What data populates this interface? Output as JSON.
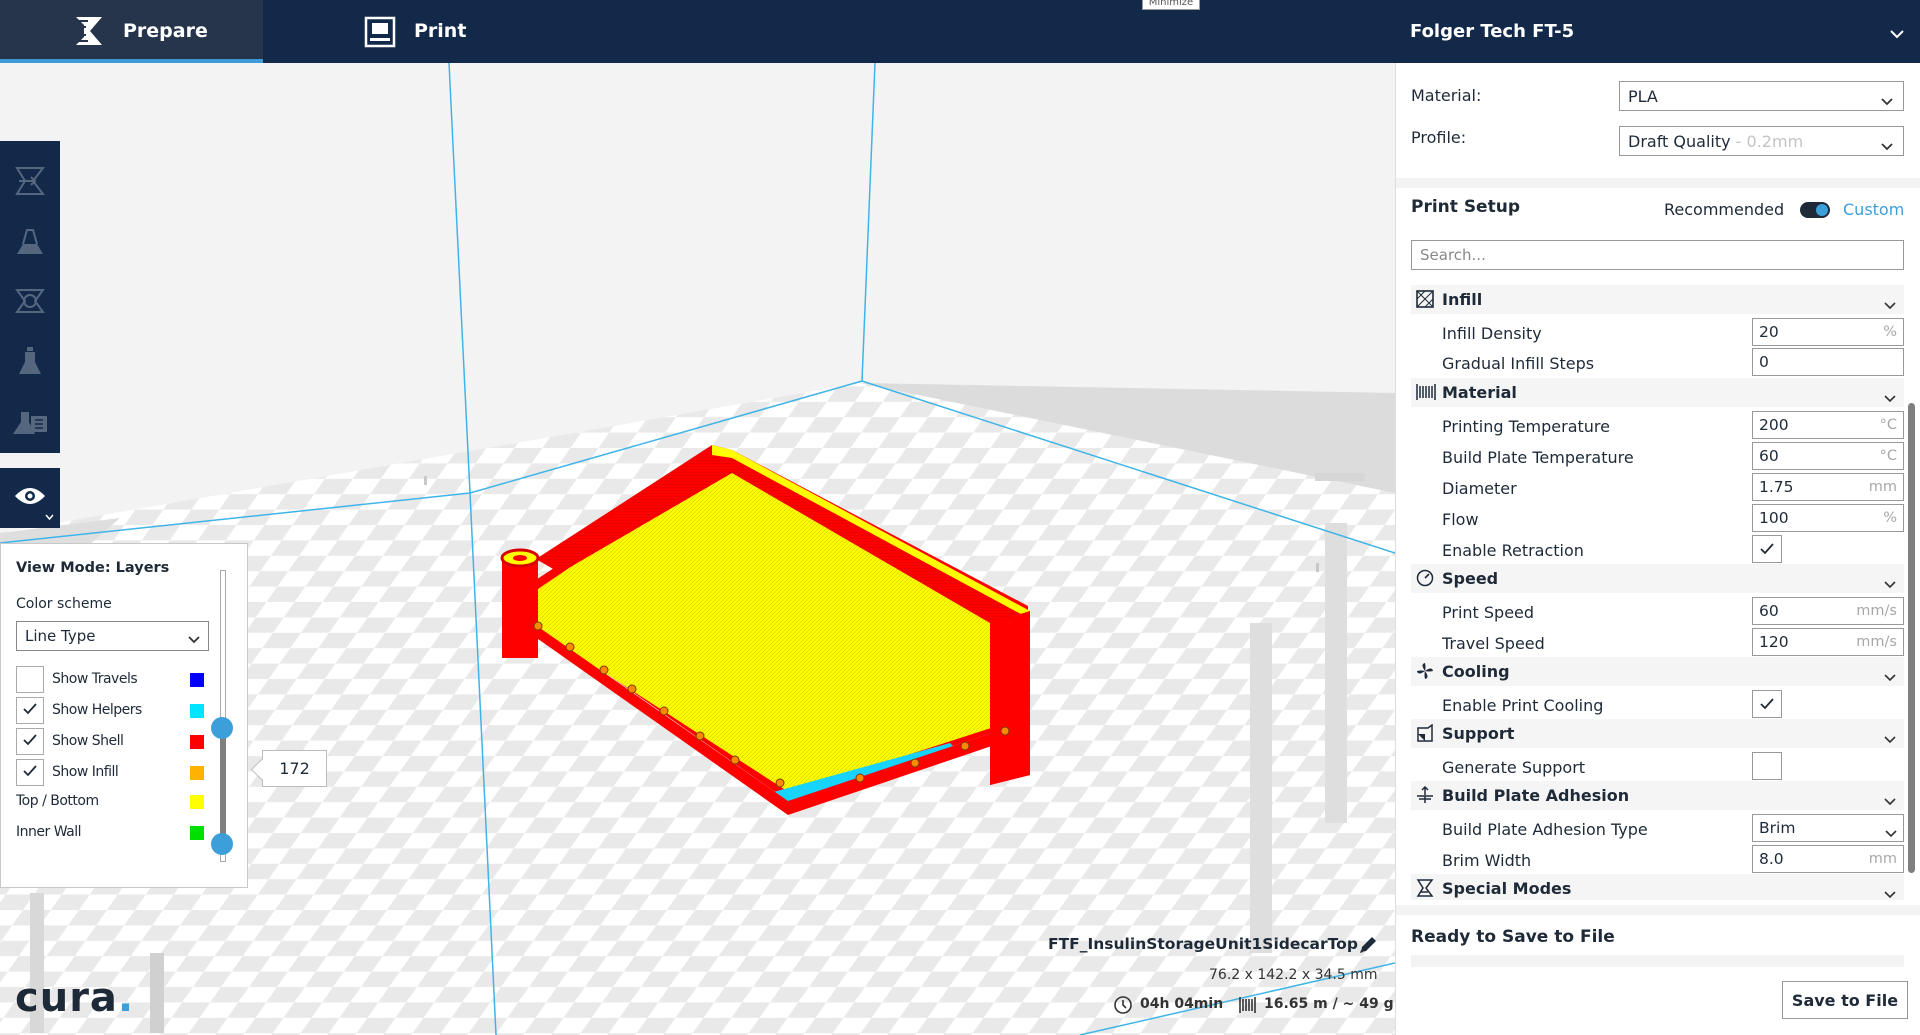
{
  "topbar": {
    "tabs": [
      {
        "label": "Prepare",
        "icon": "prepare-icon",
        "active": true
      },
      {
        "label": "Print",
        "icon": "print-icon",
        "active": false
      }
    ],
    "tooltip": "Minimize",
    "printer": "Folger Tech FT-5",
    "colors": {
      "bar": "#12294a",
      "active_tab": "#26354c",
      "accent": "#3f9ad8"
    }
  },
  "toolbar": {
    "items": [
      "open-folder-icon",
      "move-icon",
      "scale-icon",
      "rotate-icon",
      "mirror-icon",
      "per-model-settings-icon",
      "view-mode-eye-icon"
    ]
  },
  "view_panel": {
    "title": "View Mode: Layers",
    "color_scheme_label": "Color scheme",
    "color_scheme_value": "Line Type",
    "rows": [
      {
        "label": "Show Travels",
        "checked": false,
        "color": "#0000ff"
      },
      {
        "label": "Show Helpers",
        "checked": true,
        "color": "#00e5ff"
      },
      {
        "label": "Show Shell",
        "checked": true,
        "color": "#ff0000"
      },
      {
        "label": "Show Infill",
        "checked": true,
        "color": "#ffb300"
      },
      {
        "label": "Top / Bottom",
        "color": "#ffff00"
      },
      {
        "label": "Inner Wall",
        "color": "#00e000"
      }
    ],
    "layer": "172"
  },
  "model": {
    "name": "FTF_InsulinStorageUnit1SidecarTop",
    "dimensions": "76.2 x 142.2 x 34.5 mm",
    "print_time": "04h 04min",
    "material_usage": "16.65 m / ~ 49 g"
  },
  "logo": {
    "text": "cura",
    "dot": "."
  },
  "sidebar": {
    "material_label": "Material:",
    "material_value": "PLA",
    "profile_label": "Profile:",
    "profile_value": "Draft Quality",
    "profile_suffix": " - 0.2mm",
    "print_setup": "Print Setup",
    "recommended": "Recommended",
    "custom": "Custom",
    "search_placeholder": "Search...",
    "categories": [
      {
        "label": "Infill",
        "icon": "infill-icon"
      },
      {
        "label": "Material",
        "icon": "material-icon"
      },
      {
        "label": "Speed",
        "icon": "speed-icon"
      },
      {
        "label": "Cooling",
        "icon": "cooling-fan-icon"
      },
      {
        "label": "Support",
        "icon": "support-icon"
      },
      {
        "label": "Build Plate Adhesion",
        "icon": "adhesion-icon"
      },
      {
        "label": "Special Modes",
        "icon": "special-modes-icon"
      }
    ],
    "settings": [
      {
        "label": "Infill Density",
        "value": "20",
        "unit": "%"
      },
      {
        "label": "Gradual Infill Steps",
        "value": "0",
        "unit": ""
      },
      {
        "label": "Printing Temperature",
        "value": "200",
        "unit": "°C"
      },
      {
        "label": "Build Plate Temperature",
        "value": "60",
        "unit": "°C"
      },
      {
        "label": "Diameter",
        "value": "1.75",
        "unit": "mm"
      },
      {
        "label": "Flow",
        "value": "100",
        "unit": "%"
      },
      {
        "label": "Enable Retraction",
        "checked": true
      },
      {
        "label": "Print Speed",
        "value": "60",
        "unit": "mm/s"
      },
      {
        "label": "Travel Speed",
        "value": "120",
        "unit": "mm/s"
      },
      {
        "label": "Enable Print Cooling",
        "checked": true
      },
      {
        "label": "Generate Support",
        "checked": false
      },
      {
        "label": "Build Plate Adhesion Type",
        "value": "Brim"
      },
      {
        "label": "Brim Width",
        "value": "8.0",
        "unit": "mm"
      }
    ],
    "ready": "Ready to Save to File",
    "save_button": "Save to File"
  }
}
